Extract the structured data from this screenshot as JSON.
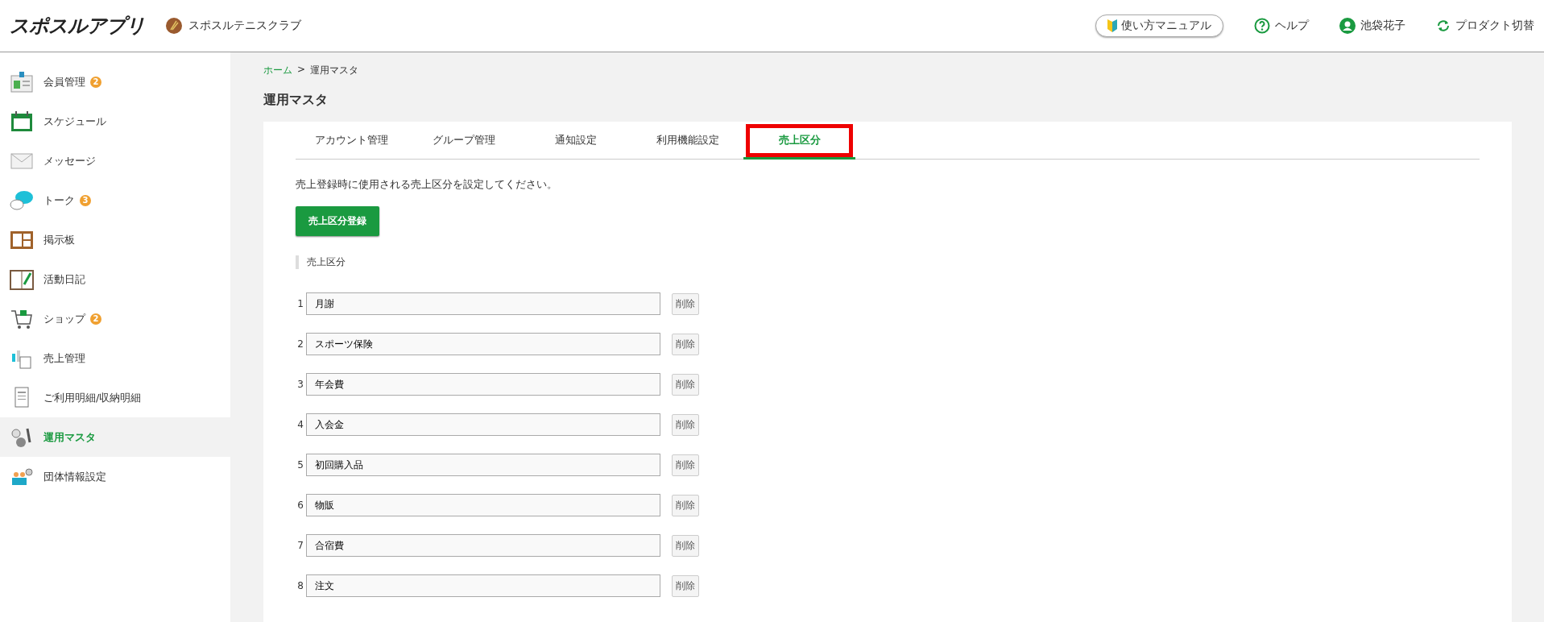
{
  "header": {
    "logo": "スポスルアプリ",
    "club_name": "スポスルテニスクラブ",
    "manual_button": "使い方マニュアル",
    "help": "ヘルプ",
    "user": "池袋花子",
    "switch_product": "プロダクト切替"
  },
  "sidebar": {
    "items": [
      {
        "label": "会員管理",
        "badge": "2",
        "selected": false
      },
      {
        "label": "スケジュール",
        "selected": false
      },
      {
        "label": "メッセージ",
        "selected": false
      },
      {
        "label": "トーク",
        "badge": "3",
        "selected": false
      },
      {
        "label": "掲示板",
        "selected": false
      },
      {
        "label": "活動日記",
        "selected": false
      },
      {
        "label": "ショップ",
        "badge": "2",
        "selected": false
      },
      {
        "label": "売上管理",
        "selected": false
      },
      {
        "label": "ご利用明細/収納明細",
        "selected": false
      },
      {
        "label": "運用マスタ",
        "selected": true
      },
      {
        "label": "団体情報設定",
        "selected": false
      }
    ]
  },
  "breadcrumb": {
    "home": "ホーム",
    "separator": ">",
    "current": "運用マスタ"
  },
  "page_title": "運用マスタ",
  "tabs": [
    {
      "label": "アカウント管理",
      "selected": false,
      "highlighted": false
    },
    {
      "label": "グループ管理",
      "selected": false,
      "highlighted": false
    },
    {
      "label": "通知設定",
      "selected": false,
      "highlighted": false
    },
    {
      "label": "利用機能設定",
      "selected": false,
      "highlighted": false
    },
    {
      "label": "売上区分",
      "selected": true,
      "highlighted": true
    }
  ],
  "description": "売上登録時に使用される売上区分を設定してください。",
  "register_button": "売上区分登録",
  "section_label": "売上区分",
  "rows": [
    {
      "number": "1",
      "value": "月謝",
      "delete": "削除"
    },
    {
      "number": "2",
      "value": "スポーツ保険",
      "delete": "削除"
    },
    {
      "number": "3",
      "value": "年会費",
      "delete": "削除"
    },
    {
      "number": "4",
      "value": "入会金",
      "delete": "削除"
    },
    {
      "number": "5",
      "value": "初回購入品",
      "delete": "削除"
    },
    {
      "number": "6",
      "value": "物販",
      "delete": "削除"
    },
    {
      "number": "7",
      "value": "合宿費",
      "delete": "削除"
    },
    {
      "number": "8",
      "value": "注文",
      "delete": "削除"
    }
  ]
}
